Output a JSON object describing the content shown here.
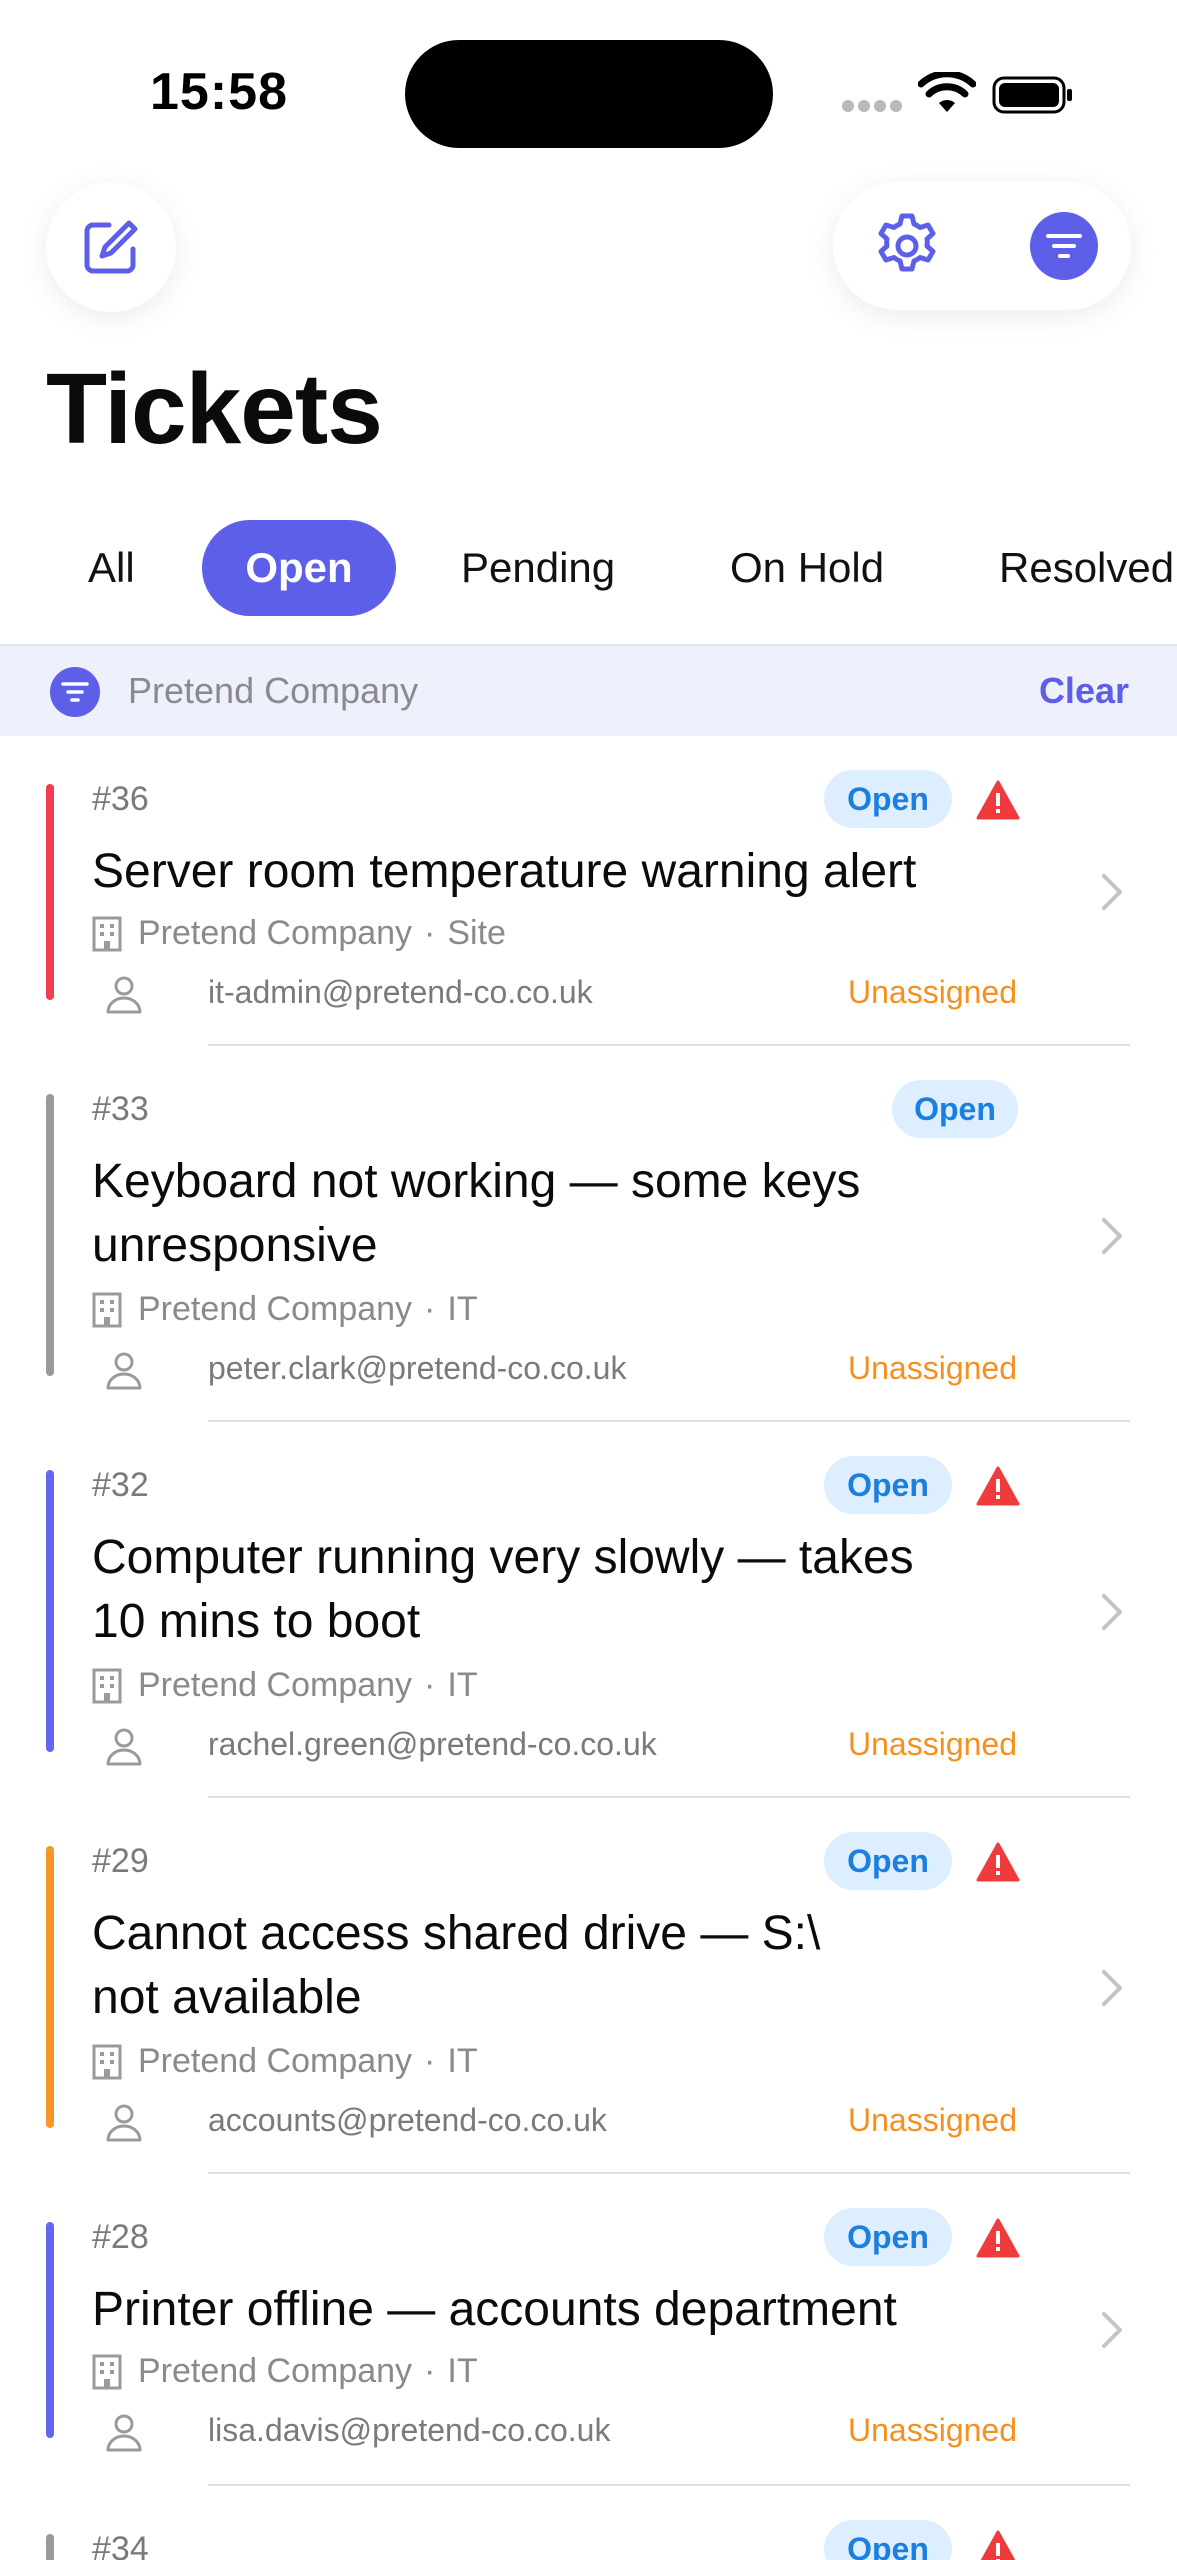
{
  "status": {
    "time": "15:58"
  },
  "header": {
    "title": "Tickets",
    "compose_icon": "compose-icon",
    "settings_icon": "gear-icon",
    "filter_icon": "filter-icon"
  },
  "tabs": [
    {
      "label": "All",
      "active": false
    },
    {
      "label": "Open",
      "active": true
    },
    {
      "label": "Pending",
      "active": false
    },
    {
      "label": "On Hold",
      "active": false
    },
    {
      "label": "Resolved",
      "active": false
    }
  ],
  "filter": {
    "label": "Pretend Company",
    "clear_label": "Clear"
  },
  "colors": {
    "accent": "#5d5fe8",
    "warning": "#ef3b3b",
    "unassigned": "#f5901e",
    "badge_bg": "#dceeff",
    "badge_text": "#1b7fe0"
  },
  "tickets": [
    {
      "number": "#36",
      "status": "Open",
      "urgent": true,
      "accent_color": "#f23d4f",
      "title_lines": [
        "Server room temperature warning alert"
      ],
      "company": "Pretend Company",
      "category": "Site",
      "email": "it-admin@pretend-co.co.uk",
      "assignee": "Unassigned"
    },
    {
      "number": "#33",
      "status": "Open",
      "urgent": false,
      "accent_color": "#9a9a9e",
      "title_lines": [
        "Keyboard not working — some keys",
        "unresponsive"
      ],
      "company": "Pretend Company",
      "category": "IT",
      "email": "peter.clark@pretend-co.co.uk",
      "assignee": "Unassigned"
    },
    {
      "number": "#32",
      "status": "Open",
      "urgent": true,
      "accent_color": "#6366f1",
      "title_lines": [
        "Computer running very slowly — takes",
        "10 mins to boot"
      ],
      "company": "Pretend Company",
      "category": "IT",
      "email": "rachel.green@pretend-co.co.uk",
      "assignee": "Unassigned"
    },
    {
      "number": "#29",
      "status": "Open",
      "urgent": true,
      "accent_color": "#f7952b",
      "title_lines": [
        "Cannot access shared drive — S:\\",
        "not available"
      ],
      "company": "Pretend Company",
      "category": "IT",
      "email": "accounts@pretend-co.co.uk",
      "assignee": "Unassigned"
    },
    {
      "number": "#28",
      "status": "Open",
      "urgent": true,
      "accent_color": "#6366f1",
      "title_lines": [
        "Printer offline — accounts department"
      ],
      "company": "Pretend Company",
      "category": "IT",
      "email": "lisa.davis@pretend-co.co.uk",
      "assignee": "Unassigned"
    },
    {
      "number": "#34",
      "status": "Open",
      "urgent": true,
      "accent_color": "#9a9a9e",
      "title_lines": [],
      "company": "",
      "category": "",
      "email": "",
      "assignee": ""
    }
  ]
}
